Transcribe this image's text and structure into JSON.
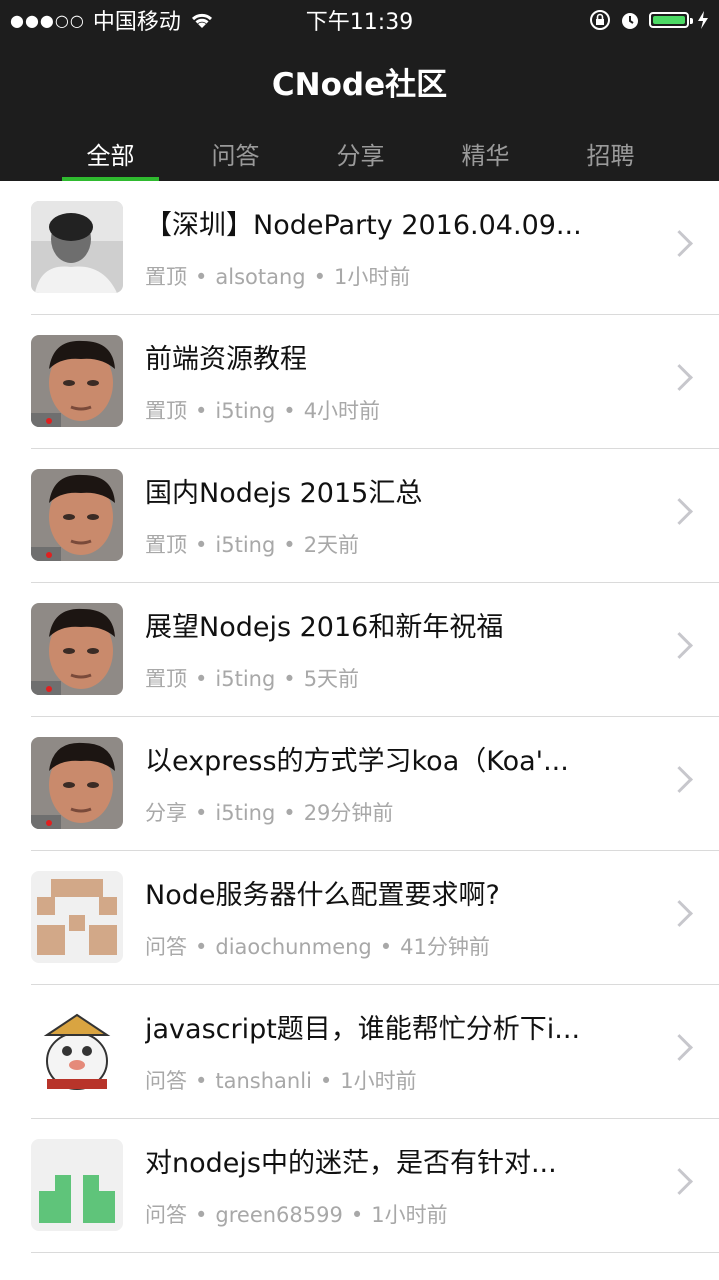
{
  "status_bar": {
    "signal": "●●●○○",
    "carrier": "中国移动",
    "time": "下午11:39"
  },
  "header": {
    "title": "CNode社区"
  },
  "tabs": [
    {
      "label": "全部",
      "active": true
    },
    {
      "label": "问答",
      "active": false
    },
    {
      "label": "分享",
      "active": false
    },
    {
      "label": "精华",
      "active": false
    },
    {
      "label": "招聘",
      "active": false
    }
  ],
  "topics": [
    {
      "title": "【深圳】NodeParty 2016.04.09...",
      "tag": "置顶",
      "author": "alsotang",
      "time": "1小时前",
      "avatar": "photo-gray"
    },
    {
      "title": "前端资源教程",
      "tag": "置顶",
      "author": "i5ting",
      "time": "4小时前",
      "avatar": "photo-face"
    },
    {
      "title": "国内Nodejs 2015汇总",
      "tag": "置顶",
      "author": "i5ting",
      "time": "2天前",
      "avatar": "photo-face"
    },
    {
      "title": "展望Nodejs 2016和新年祝福",
      "tag": "置顶",
      "author": "i5ting",
      "time": "5天前",
      "avatar": "photo-face"
    },
    {
      "title": "以express的方式学习koa（Koa'...",
      "tag": "分享",
      "author": "i5ting",
      "time": "29分钟前",
      "avatar": "photo-face"
    },
    {
      "title": "Node服务器什么配置要求啊?",
      "tag": "问答",
      "author": "diaochunmeng",
      "time": "41分钟前",
      "avatar": "identicon-tan"
    },
    {
      "title": "javascript题目，谁能帮忙分析下i...",
      "tag": "问答",
      "author": "tanshanli",
      "time": "1小时前",
      "avatar": "cartoon"
    },
    {
      "title": "对nodejs中的迷茫，是否有针对...",
      "tag": "问答",
      "author": "green68599",
      "time": "1小时前",
      "avatar": "identicon-green"
    }
  ],
  "colors": {
    "header_bg": "#1d1d1d",
    "tab_indicator": "#2fba2f",
    "meta_text": "#a8a8a8"
  }
}
